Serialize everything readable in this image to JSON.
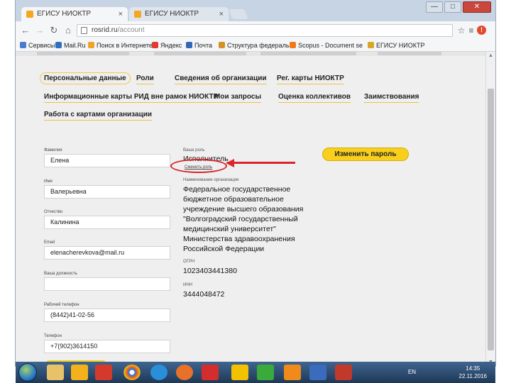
{
  "browser": {
    "tabs": [
      {
        "title": "ЕГИСУ НИОКТР",
        "close": "×"
      },
      {
        "title": "ЕГИСУ НИОКТР",
        "close": "×"
      }
    ],
    "window_controls": {
      "minimize": "—",
      "maximize": "□",
      "close": "✕"
    },
    "url_host": "rosrid.ru",
    "url_path": "/account",
    "alert_badge": "!",
    "bookmarks": [
      {
        "label": "Сервисы",
        "color": "#4a7bd1"
      },
      {
        "label": "Mail.Ru",
        "color": "#2d6fc0"
      },
      {
        "label": "Поиск в Интернете",
        "color": "#f0a32a"
      },
      {
        "label": "Яндекс",
        "color": "#e33b2e"
      },
      {
        "label": "Почта",
        "color": "#3567b8"
      },
      {
        "label": "Структура федераль",
        "color": "#d6902a"
      },
      {
        "label": "Scopus - Document se",
        "color": "#f07a1a"
      },
      {
        "label": "ЕГИСУ НИОКТР",
        "color": "#d9a52a"
      }
    ]
  },
  "account": {
    "nav": {
      "personal": "Персональные данные",
      "roles": "Роли",
      "org_info": "Сведения об организации",
      "reg_cards": "Рег. карты НИОКТР",
      "info_cards": "Информационные карты РИД вне рамок НИОКТР",
      "my_requests": "Мои запросы",
      "team_eval": "Оценка коллективов",
      "borrowing": "Заимствования",
      "org_cards": "Работа с картами организации"
    },
    "fields": {
      "surname_label": "Фамилия",
      "surname": "Елена",
      "name_label": "Имя",
      "name": "Валерьевна",
      "patronymic_label": "Отчество",
      "patronymic": "Калинина",
      "email_label": "Email",
      "email": "elenacherevkova@mail.ru",
      "position_label": "Ваша должность",
      "position": "",
      "work_phone_label": "Рабочий телефон",
      "work_phone": "(8442)41-02-56",
      "phone_label": "Телефон",
      "phone": "+7(902)3614150"
    },
    "role_label": "Ваша роль",
    "role": "Исполнитель",
    "change_role": "Сменить роль",
    "change_password": "Изменить пароль",
    "org_label": "Наименование организации",
    "org_name_lines": [
      "Федеральное государственное",
      "бюджетное образовательное",
      "учреждение высшего образования",
      "\"Волгоградский государственный",
      "медицинский университет\"",
      "Министерства здравоохранения",
      "Российской Федерации"
    ],
    "ogrn_label": "ОГРН",
    "ogrn": "1023403441380",
    "inn_label": "ИНН",
    "inn": "3444048472"
  },
  "taskbar": {
    "lang": "EN",
    "time": "14:35",
    "date": "22.11.2016",
    "app_colors": [
      "#e8c268",
      "#f3b21b",
      "#d33a2c",
      "#ffffff",
      "#2a8fd8",
      "#e8712a",
      "#d42d2d",
      "#f2c200",
      "#3aaa3a",
      "#f08a1a",
      "#3b6bbd",
      "#c0392b"
    ]
  }
}
